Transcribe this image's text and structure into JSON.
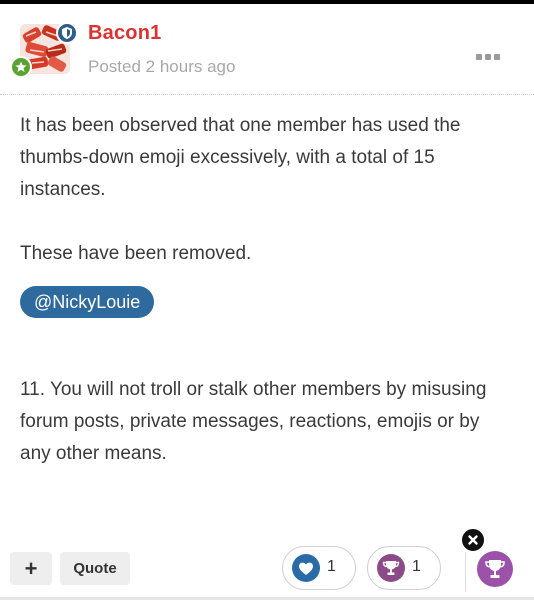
{
  "post": {
    "author": "Bacon1",
    "posted_time": "Posted 2 hours ago",
    "paragraphs": [
      "It has been observed that one member has used the thumbs-down emoji excessively, with a total of 15 instances.",
      "These have been removed."
    ],
    "mention": "@NickyLouie",
    "rule_text": "11. You will not troll or stalk other members by misusing forum posts, private messages, reactions, emojis or by any other means."
  },
  "footer": {
    "plus_label": "+",
    "quote_label": "Quote",
    "reactions": [
      {
        "type": "like",
        "icon": "heart-icon",
        "count": "1",
        "color": "#2a6aa6"
      },
      {
        "type": "trophy",
        "icon": "trophy-icon",
        "count": "1",
        "color": "#8c4a87"
      }
    ],
    "react_button_icon": "trophy-icon",
    "close_icon": "close-icon"
  },
  "colors": {
    "author_name": "#e03131",
    "mention_bg": "#2e6a9e",
    "react_button": "#9b52a8",
    "moderator_badge": "#2f5d8a",
    "rank_badge": "#5aa332"
  }
}
